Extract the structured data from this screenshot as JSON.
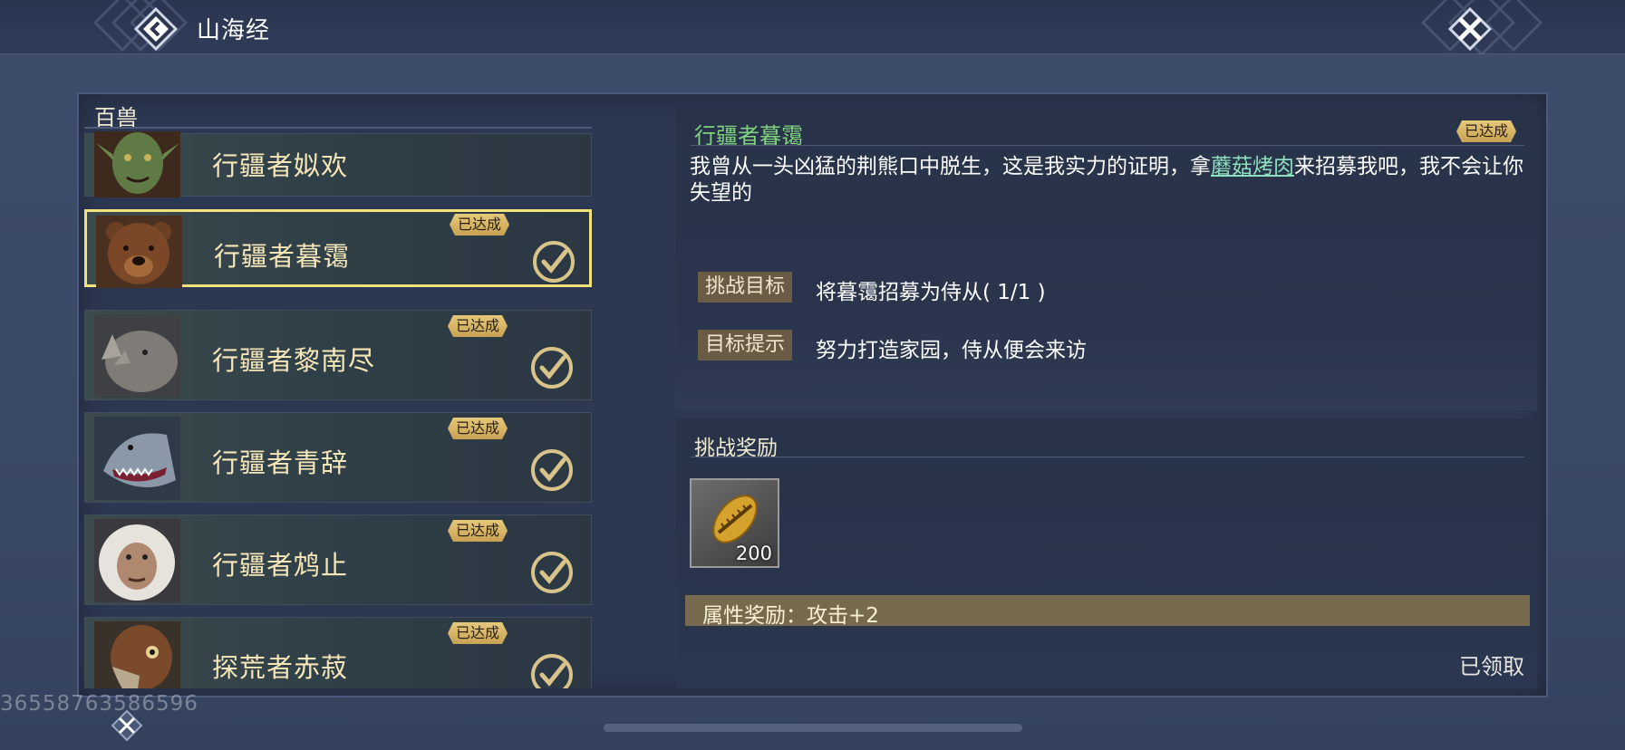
{
  "header": {
    "title": "山海经",
    "back_icon": "back-arrow-icon",
    "close_icon": "close-icon"
  },
  "list": {
    "heading": "百兽",
    "items": [
      {
        "name": "行疆者姒欢",
        "portrait": "goblin-portrait",
        "badge": "",
        "checked": false,
        "selected": false
      },
      {
        "name": "行疆者暮霭",
        "portrait": "bear-portrait",
        "badge": "已达成",
        "checked": true,
        "selected": true
      },
      {
        "name": "行疆者黎南尽",
        "portrait": "rhino-portrait",
        "badge": "已达成",
        "checked": true,
        "selected": false
      },
      {
        "name": "行疆者青辞",
        "portrait": "shark-portrait",
        "badge": "已达成",
        "checked": true,
        "selected": false
      },
      {
        "name": "行疆者鸩止",
        "portrait": "ape-portrait",
        "badge": "已达成",
        "checked": true,
        "selected": false
      },
      {
        "name": "探荒者赤菽",
        "portrait": "bird-portrait",
        "badge": "已达成",
        "checked": true,
        "selected": false
      }
    ]
  },
  "detail": {
    "title": "行疆者暮霭",
    "badge": "已达成",
    "desc_before": "我曾从一头凶猛的荆熊口中脱生，这是我实力的证明，拿",
    "desc_link": "蘑菇烤肉",
    "desc_after": "来招募我吧，我不会让你失望的",
    "goal_label": "挑战目标",
    "goal_value": "将暮霭招募为侍从( 1/1 )",
    "hint_label": "目标提示",
    "hint_value": "努力打造家园，侍从便会来访"
  },
  "reward": {
    "title": "挑战奖励",
    "item_icon": "gold-shell-icon",
    "item_qty": "200",
    "attr_text": "属性奖励：攻击+2",
    "claimed": "已领取"
  },
  "footer": {
    "watermark": "365587635865​96",
    "close_icon": "close-icon"
  },
  "colors": {
    "accent_gold": "#e6c87a",
    "selected_border": "#f2e27a",
    "title_green": "#7fd37f",
    "link_green": "#8ee1bf"
  }
}
